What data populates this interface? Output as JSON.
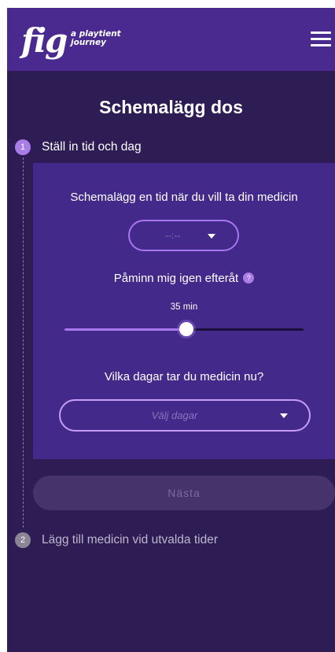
{
  "header": {
    "logo_text": "fig",
    "logo_tagline_1": "a playtient",
    "logo_tagline_2": "journey",
    "menu_icon": "hamburger-menu-icon"
  },
  "page": {
    "title": "Schemalägg dos"
  },
  "steps": [
    {
      "number": "1",
      "label": "Ställ in tid och dag",
      "active": true
    },
    {
      "number": "2",
      "label": "Lägg till medicin vid utvalda tider",
      "active": false
    }
  ],
  "form": {
    "heading": "Schemalägg en tid när du vill ta din medicin",
    "time_value": "--:--",
    "remind_label": "Påminn mig igen efteråt",
    "help_icon_text": "?",
    "slider_value_label": "35 min",
    "slider_fraction": 0.51,
    "days_question": "Vilka dagar tar du medicin nu?",
    "days_placeholder": "Välj dagar"
  },
  "next_button_label": "Nästa",
  "colors": {
    "background": "#2e1d55",
    "header": "#4a2a8f",
    "card": "#43298a",
    "accent": "#a877f0",
    "disabled_button": "#47336c"
  }
}
